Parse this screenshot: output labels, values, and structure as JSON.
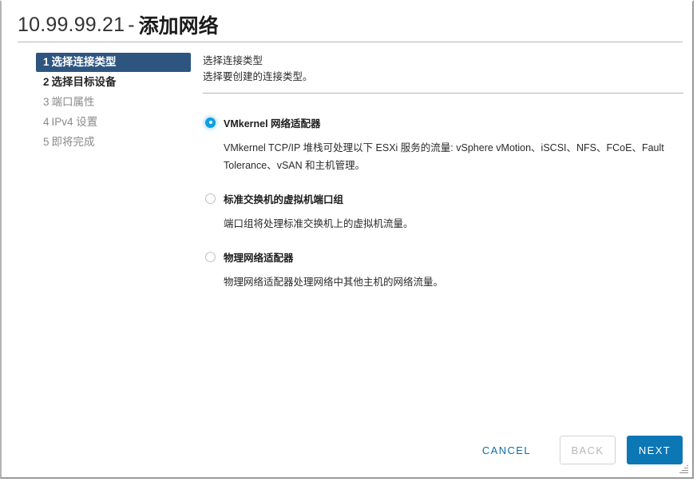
{
  "window": {
    "title_ip": "10.99.99.21",
    "title_separator": "-",
    "title_name": "添加网络",
    "resize_grip_icon": "resize-grip-icon"
  },
  "wizard": {
    "steps": [
      {
        "num": "1",
        "label": "选择连接类型",
        "state": "active"
      },
      {
        "num": "2",
        "label": "选择目标设备",
        "state": "done"
      },
      {
        "num": "3",
        "label": "端口属性",
        "state": "pending"
      },
      {
        "num": "4",
        "label": "IPv4 设置",
        "state": "pending"
      },
      {
        "num": "5",
        "label": "即将完成",
        "state": "pending"
      }
    ]
  },
  "content": {
    "heading": "选择连接类型",
    "subheading": "选择要创建的连接类型。",
    "options": [
      {
        "label": "VMkernel 网络适配器",
        "description": "VMkernel TCP/IP 堆栈可处理以下 ESXi 服务的流量: vSphere vMotion、iSCSI、NFS、FCoE、Fault Tolerance、vSAN 和主机管理。",
        "selected": true
      },
      {
        "label": "标准交换机的虚拟机端口组",
        "description": "端口组将处理标准交换机上的虚拟机流量。",
        "selected": false
      },
      {
        "label": "物理网络适配器",
        "description": "物理网络适配器处理网络中其他主机的网络流量。",
        "selected": false
      }
    ]
  },
  "footer": {
    "cancel_label": "CANCEL",
    "back_label": "BACK",
    "next_label": "NEXT"
  },
  "colors": {
    "active_step_bg": "#2e557f",
    "primary_button": "#0c77b5",
    "link_text": "#0b6ea8",
    "radio_selected": "#0e9fe0"
  }
}
